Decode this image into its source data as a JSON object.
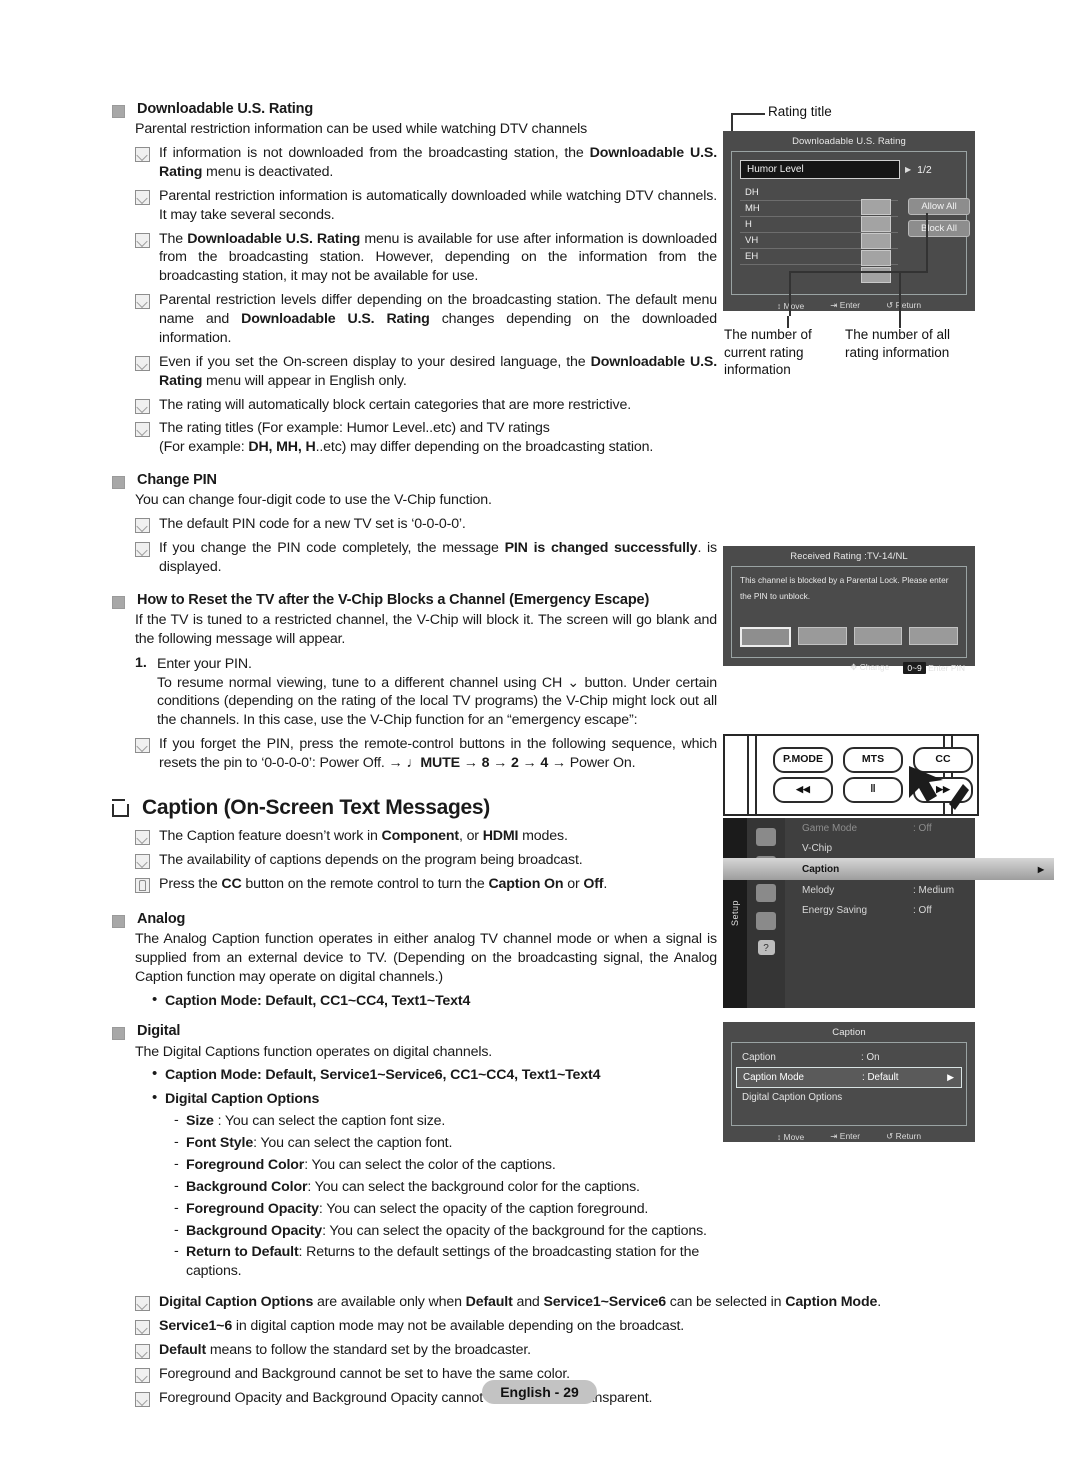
{
  "page": {
    "footer_label": "English - 29"
  },
  "sections": {
    "downloadable": {
      "title": "Downloadable U.S. Rating",
      "intro": "Parental restriction information can be used while watching DTV channels",
      "notes": [
        "If information is not downloaded from the broadcasting station, the <b>Downloadable U.S. Rating</b> menu is deactivated.",
        "Parental restriction information is automatically downloaded while watching DTV channels. It may take several seconds.",
        "The <b>Downloadable U.S. Rating</b> menu is available for use after information is downloaded from the broadcasting station. However, depending on the information from the broadcasting station, it may not be available for use.",
        "Parental restriction levels differ depending on the broadcasting station. The default menu name and <b>Downloadable U.S. Rating</b> changes depending on the downloaded information.",
        "Even if you set the On-screen display to your desired language, the <b>Downloadable U.S. Rating</b> menu will appear in English only.",
        "The rating will automatically block certain categories that are more restrictive.",
        "The rating titles (For example: Humor Level..etc) and TV ratings<br>(For example: <b>DH, MH, H</b>..etc) may differ depending on the broadcasting station."
      ]
    },
    "change_pin": {
      "title": "Change PIN",
      "intro": "You can change four-digit code to use the V-Chip function.",
      "notes": [
        "The default PIN code for a new TV set is ‘0-0-0-0’.",
        "If you change the PIN code completely, the message <b>PIN is changed successfully</b>. is displayed."
      ]
    },
    "reset": {
      "title": "How to Reset the TV after the V-Chip Blocks a Channel (Emergency Escape)",
      "intro": "If the TV is tuned to a restricted channel, the V-Chip will block it. The screen will go blank and the following message will appear.",
      "step_number": "1.",
      "step_title": "Enter your PIN.",
      "step_body": "To resume normal viewing, tune to a different channel using CH ⌄ button. Under certain conditions (depending on the rating of the local TV programs) the V-Chip might lock out all the channels. In this case, use the V-Chip function for an “emergency escape”:",
      "notes": [
        "If you forget the PIN, press the remote-control buttons in the following sequence, which resets the pin to ‘0-0-0-0’: Power Off. → ♩<b>MUTE</b> → <b>8</b> → <b>2</b> → <b>4</b> → Power On."
      ]
    },
    "caption": {
      "title": "Caption (On-Screen Text Messages)",
      "notes": [
        "The Caption feature doesn’t work in <b>Component</b>, or <b>HDMI</b> modes.",
        "The availability of captions depends on the program being broadcast.",
        "Press the <b>CC</b> button on the remote control to turn the <b>Caption On</b> or <b>Off</b>."
      ]
    },
    "analog": {
      "title": "Analog",
      "intro": "The Analog Caption function operates in either analog TV channel mode or when a signal is supplied from an external device to TV. (Depending on the broadcasting signal, the Analog Caption function may operate on digital channels.)",
      "bullets": [
        "<b>Caption Mode</b>: <b>Default, CC1~CC4, Text1~Text4</b>"
      ]
    },
    "digital": {
      "title": "Digital",
      "intro": "The Digital Captions function operates on digital channels.",
      "bullet_mode": "<b>Caption Mode</b>: <b>Default</b>, <b>Service1~Service6</b>, <b>CC1~CC4</b>, <b>Text1~Text4</b>",
      "bullet_options": "Digital Caption Options",
      "options": [
        "<b>Size</b> : You can select the caption font size.",
        "<b>Font Style</b>: You can select the caption font.",
        "<b>Foreground Color</b>: You can select the color of the captions.",
        "<b>Background Color</b>: You can select the background color for the captions.",
        "<b>Foreground Opacity</b>: You can select the opacity of the caption foreground.",
        "<b>Background Opacity</b>: You can select the opacity of the background for the captions.",
        "<b>Return to Default</b>: Returns to the default settings of the broadcasting station for the captions."
      ],
      "notes": [
        "<b>Digital Caption Options</b> are available only when <b>Default</b> and <b>Service1~Service6</b> can be selected in <b>Caption Mode</b>.",
        "<b>Service1~6</b> in digital caption mode may not be available depending on the broadcast.",
        "<b>Default</b> means to follow the standard set by the broadcaster.",
        "Foreground and Background cannot be set to have the same color.",
        "Foreground Opacity and Background Opacity cannot be both set to Transparent."
      ]
    }
  },
  "callouts": {
    "rating_title": "Rating title",
    "current_rating": "The number of current rating information",
    "all_rating": "The number of all rating information"
  },
  "osd_rating": {
    "title": "Downloadable U.S. Rating",
    "field_value": "Humor Level",
    "page_count": "1/2",
    "rows": [
      "DH",
      "MH",
      "H",
      "VH",
      "EH"
    ],
    "allow_all": "Allow All",
    "block_all": "Block All",
    "foot": {
      "move": "Move",
      "enter": "Enter",
      "return": "Return"
    }
  },
  "osd_blocked": {
    "title": "Received Rating :TV-14/NL",
    "message": "This channel is blocked by a Parental Lock. Please enter the PIN to unblock.",
    "foot": {
      "change": "Change",
      "key": "0~9",
      "enter_pin": "Enter PIN"
    }
  },
  "remote": {
    "buttons_row1": [
      "P.MODE",
      "MTS",
      "CC"
    ],
    "buttons_row2": [
      "◀◀",
      "‖",
      "▶▶"
    ]
  },
  "osd_setup": {
    "sidebar_label": "Setup",
    "rows": [
      {
        "label": "Game Mode",
        "value": ": Off",
        "state": "dim"
      },
      {
        "label": "V-Chip",
        "value": "",
        "state": "normal"
      },
      {
        "label": "Caption",
        "value": "",
        "state": "selected"
      },
      {
        "label": "Melody",
        "value": ": Medium",
        "state": "normal"
      },
      {
        "label": "Energy Saving",
        "value": ": Off",
        "state": "normal"
      }
    ]
  },
  "osd_caption": {
    "title": "Caption",
    "rows": [
      {
        "label": "Caption",
        "value": ": On",
        "state": "normal"
      },
      {
        "label": "Caption Mode",
        "value": ": Default",
        "state": "selected"
      },
      {
        "label": "Digital Caption Options",
        "value": "",
        "state": "normal"
      }
    ],
    "foot": {
      "move": "Move",
      "enter": "Enter",
      "return": "Return"
    }
  }
}
